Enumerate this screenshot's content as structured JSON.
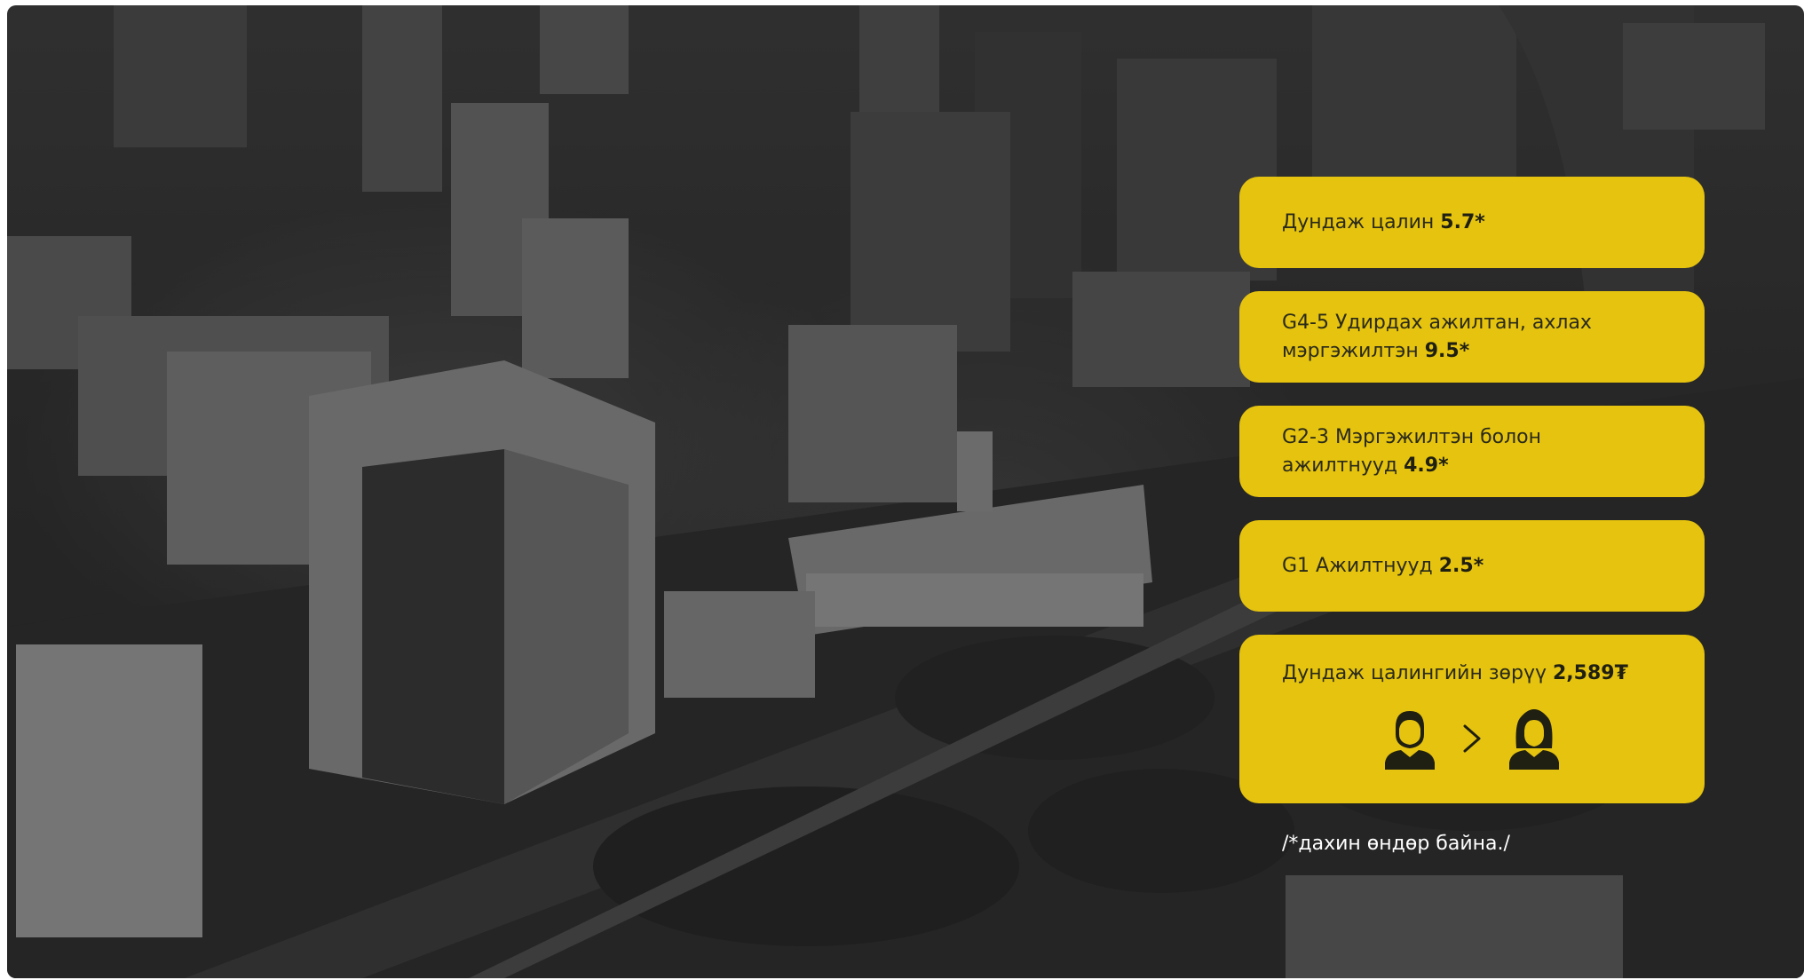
{
  "stats": {
    "average_salary": {
      "label": "Дундаж цалин",
      "value": "5.7*"
    },
    "g45": {
      "label_line1": "G4-5 Удирдах ажилтан, ахлах",
      "label_line2": "мэргэжилтэн",
      "value": "9.5*"
    },
    "g23": {
      "label_line1": "G2-3 Мэргэжилтэн болон",
      "label_line2": "ажилтнууд",
      "value": "4.9*"
    },
    "g1": {
      "label": "G1 Ажилтнууд",
      "value": "2.5*"
    },
    "gap": {
      "label": "Дундаж цалингийн зөрүү",
      "value": "2,589₮"
    }
  },
  "footnote": "/*дахин өндөр байна./",
  "colors": {
    "card": "#e5c30e",
    "card_text": "#2a2a1a",
    "footnote": "#ffffff",
    "icon": "#1f1f12"
  },
  "icons": {
    "male": "male-person-icon",
    "compare": "greater-than-icon",
    "female": "female-person-icon"
  }
}
